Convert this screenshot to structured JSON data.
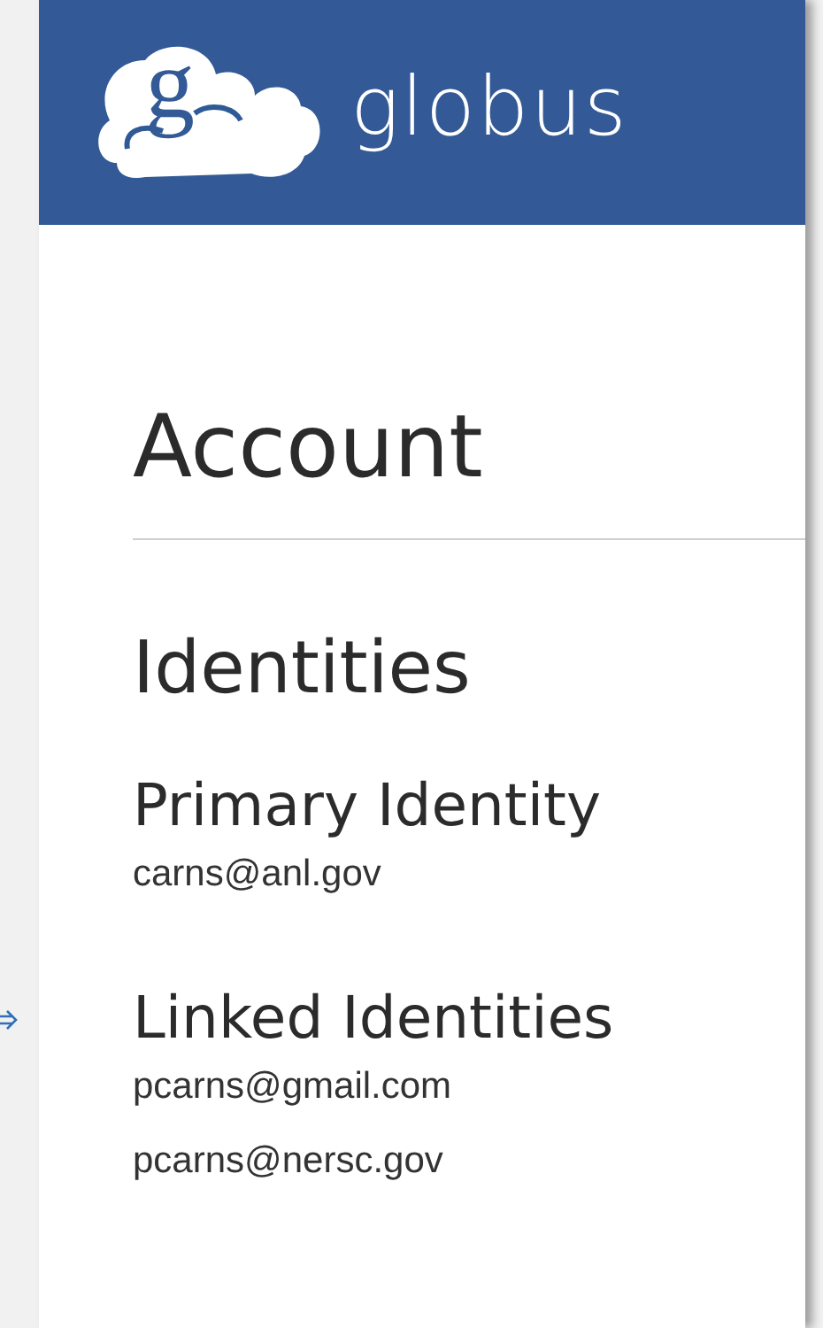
{
  "header": {
    "logo_mark": "g",
    "wordmark": "globus"
  },
  "page_title": "Account",
  "section_title": "Identities",
  "primary": {
    "heading": "Primary Identity",
    "identities": [
      "carns@anl.gov"
    ]
  },
  "linked": {
    "heading": "Linked Identities",
    "identities": [
      "pcarns@gmail.com",
      "pcarns@nersc.gov"
    ]
  }
}
